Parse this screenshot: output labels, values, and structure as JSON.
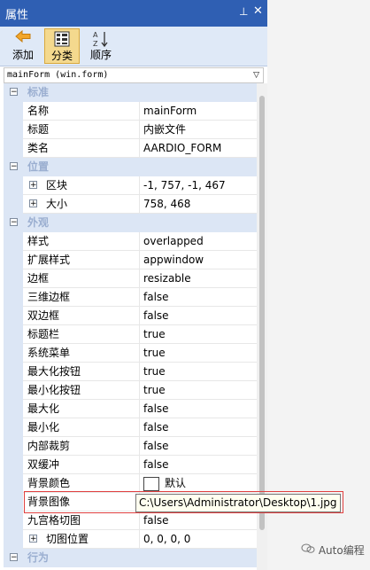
{
  "window": {
    "title": "属性",
    "pin_glyph": "⊥",
    "close_glyph": "✕"
  },
  "toolbar": {
    "add_label": "添加",
    "category_label": "分类",
    "order_label": "顺序"
  },
  "object_combo": {
    "value": "mainForm (win.form)",
    "arrow": "▽"
  },
  "categories": [
    {
      "label": "标准",
      "rows": [
        {
          "name": "名称",
          "value": "mainForm"
        },
        {
          "name": "标题",
          "value": "内嵌文件"
        },
        {
          "name": "类名",
          "value": "AARDIO_FORM"
        }
      ]
    },
    {
      "label": "位置",
      "rows": [
        {
          "name": "区块",
          "value": "-1, 757, -1, 467",
          "expandable": true
        },
        {
          "name": "大小",
          "value": "758, 468",
          "expandable": true
        }
      ]
    },
    {
      "label": "外观",
      "rows": [
        {
          "name": "样式",
          "value": "overlapped"
        },
        {
          "name": "扩展样式",
          "value": "appwindow"
        },
        {
          "name": "边框",
          "value": "resizable"
        },
        {
          "name": "三维边框",
          "value": "false"
        },
        {
          "name": "双边框",
          "value": "false"
        },
        {
          "name": "标题栏",
          "value": "true"
        },
        {
          "name": "系统菜单",
          "value": "true"
        },
        {
          "name": "最大化按钮",
          "value": "true"
        },
        {
          "name": "最小化按钮",
          "value": "true"
        },
        {
          "name": "最大化",
          "value": "false"
        },
        {
          "name": "最小化",
          "value": "false"
        },
        {
          "name": "内部裁剪",
          "value": "false"
        },
        {
          "name": "双缓冲",
          "value": "false"
        },
        {
          "name": "背景颜色",
          "value": "默认",
          "swatch": true
        },
        {
          "name": "背景图像",
          "value": ""
        },
        {
          "name": "九宫格切图",
          "value": "false"
        },
        {
          "name": "切图位置",
          "value": "0, 0, 0, 0",
          "expandable": true
        }
      ]
    },
    {
      "label": "行为",
      "rows": []
    }
  ],
  "tooltip": {
    "text": "C:\\Users\\Administrator\\Desktop\\1.jpg"
  },
  "watermark": {
    "text": "Auto编程"
  },
  "colors": {
    "titlebar": "#2f5fb3",
    "category_bg": "#dce6f5",
    "highlight": "#e04040"
  }
}
